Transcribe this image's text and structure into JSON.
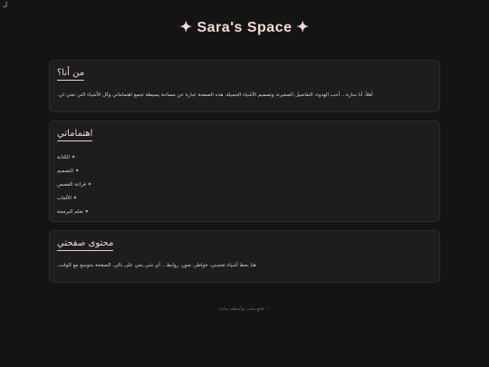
{
  "corner_mark": "ل",
  "site_title": "✦ Sara's Space ✦",
  "about": {
    "title": "من أنا؟",
    "text": "أهلاً، أنا سارة... أحب الهدوء، التفاصيل الصغيرة، وتصميم الأشياء الجميلة. هذه الصفحة عبارة عن مساحة بسيطة تجمع اهتماماتي وكل الأشياء التي تعني لي."
  },
  "interests": {
    "title": "اهتماماتي",
    "items": [
      "✦ الكتابة",
      "✦ التصميم",
      "✦ قراءة القصص",
      "✦ الألعاب",
      "✦ تعلم البرمجة"
    ]
  },
  "content": {
    "title": "محتوى صفحتي",
    "text": "هنا بحط أشياء تعجبني، خواطر، صور، روابط... أي شي يجي على بالي. الصفحة بتتوسع مع الوقت."
  },
  "footer": "♡ صُنع بحب بواسطة سارة",
  "colors": {
    "background": "#141414",
    "card": "#1d1d1d",
    "accent": "#f0cfcb"
  }
}
